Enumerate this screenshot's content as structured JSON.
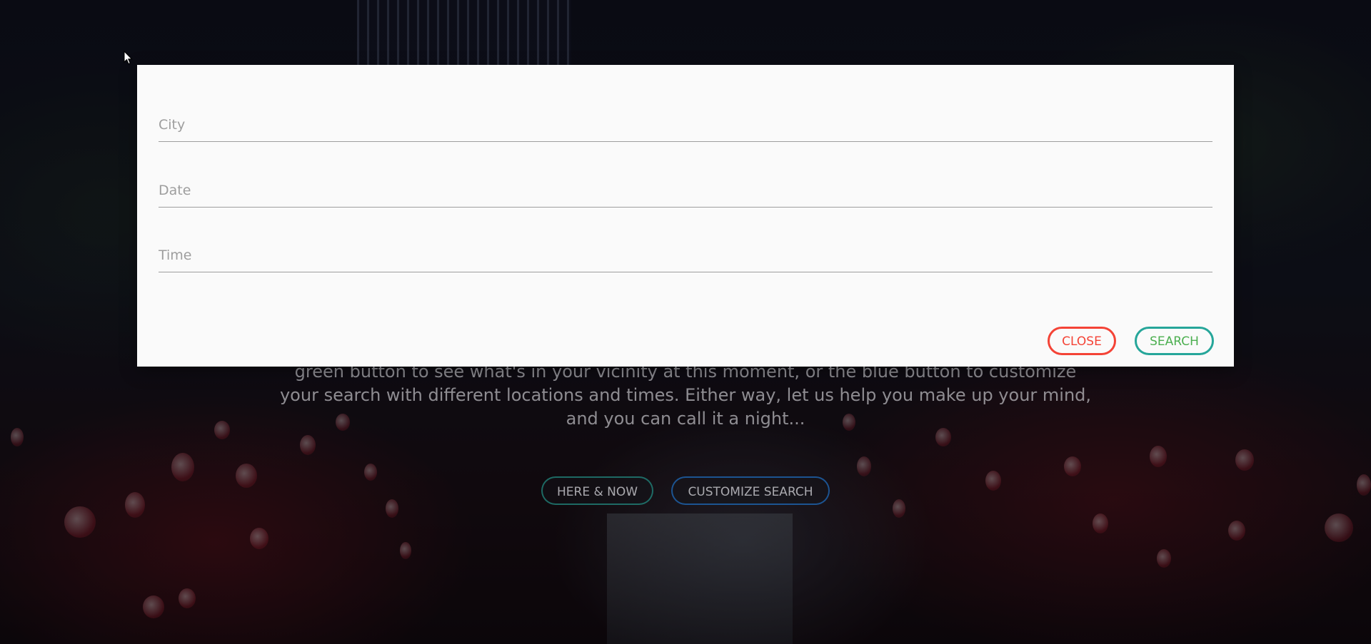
{
  "hero": {
    "lines": [
      "green button to see what's in your vicinity at this moment, or the blue button to customize",
      "your search with different locations and times. Either way, let us help you make up your mind,",
      "and you can call it a night..."
    ],
    "here_now_label": "HERE & NOW",
    "customize_label": "CUSTOMIZE SEARCH"
  },
  "modal": {
    "city_placeholder": "City",
    "date_placeholder": "Date",
    "time_placeholder": "Time",
    "close_label": "CLOSE",
    "search_label": "SEARCH"
  },
  "colors": {
    "close": "#f44336",
    "search_border": "#26a69a",
    "search_text": "#4caf50",
    "customize_border": "#2178d2",
    "modal_bg": "#fafafa"
  },
  "icons": {
    "cursor": "mouse-pointer-icon"
  }
}
